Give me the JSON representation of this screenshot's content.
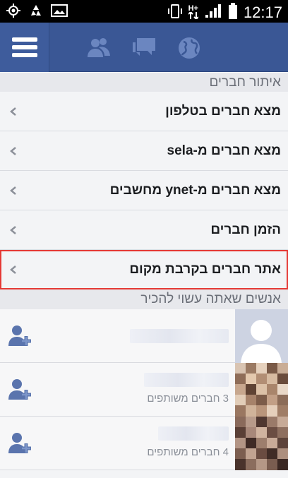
{
  "status_bar": {
    "time": "12:17",
    "network": "H+",
    "icons_left": [
      "gps-icon",
      "recycle-icon",
      "image-icon"
    ],
    "icons_right": [
      "vibrate-icon",
      "network-icon",
      "signal-icon",
      "battery-icon"
    ]
  },
  "app_bar": {
    "colors": {
      "bar": "#3a5795",
      "icon": "#6b86c0"
    },
    "icons": [
      "menu-icon",
      "friends-icon",
      "messages-icon",
      "globe-icon"
    ]
  },
  "find_friends": {
    "header": "איתור חברים",
    "items": [
      {
        "label": "מצא חברים בטלפון"
      },
      {
        "label": "מצא חברים מ-sela"
      },
      {
        "label": "מצא חברים מ-ynet מחשבים"
      },
      {
        "label": "הזמן חברים"
      },
      {
        "label": "אתר חברים בקרבת מקום",
        "selected": true
      }
    ]
  },
  "people_you_may_know": {
    "header": "אנשים שאתה עשוי להכיר",
    "people": [
      {
        "mutual": ""
      },
      {
        "mutual": "3 חברים משותפים"
      },
      {
        "mutual": "4 חברים משותפים"
      }
    ]
  },
  "colors": {
    "highlight_border": "#e53935"
  }
}
